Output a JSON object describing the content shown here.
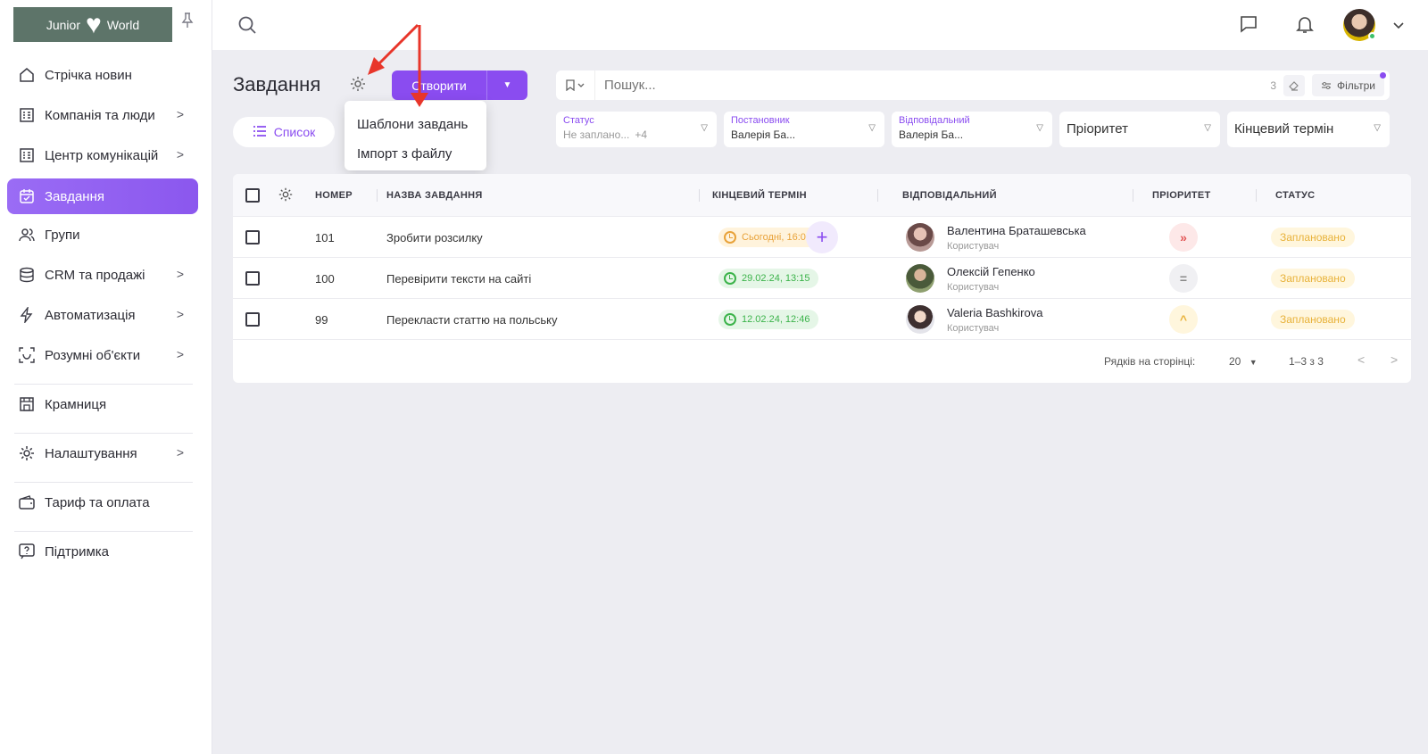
{
  "sidebar": {
    "logo_left": "Junior",
    "logo_right": "World",
    "items": [
      {
        "label": "Стрічка новин",
        "icon": "home-icon",
        "chevron": false
      },
      {
        "label": "Компанія та люди",
        "icon": "building-icon",
        "chevron": true
      },
      {
        "label": "Центр комунікацій",
        "icon": "building-icon",
        "chevron": true
      },
      {
        "label": "Завдання",
        "icon": "calendar-check-icon",
        "chevron": false,
        "active": true
      },
      {
        "label": "Групи",
        "icon": "users-icon",
        "chevron": false
      },
      {
        "label": "CRM та продажі",
        "icon": "database-icon",
        "chevron": true
      },
      {
        "label": "Автоматизація",
        "icon": "bolt-icon",
        "chevron": true
      },
      {
        "label": "Розумні об'єкти",
        "icon": "scan-icon",
        "chevron": true
      },
      {
        "label": "Крамниця",
        "icon": "store-icon",
        "chevron": false
      },
      {
        "label": "Налаштування",
        "icon": "gear-icon",
        "chevron": true
      },
      {
        "label": "Тариф та оплата",
        "icon": "wallet-icon",
        "chevron": false
      },
      {
        "label": "Підтримка",
        "icon": "help-icon",
        "chevron": false
      }
    ]
  },
  "header": {
    "title": "Завдання",
    "create_label": "Створити",
    "view_label": "Список",
    "dropdown": [
      "Шаблони завдань",
      "Імпорт з файлу"
    ]
  },
  "search": {
    "placeholder": "Пошук...",
    "count": "3",
    "filters_label": "Фільтри"
  },
  "filters": [
    {
      "label": "Статус",
      "value": "Не заплано...",
      "more": "+4"
    },
    {
      "label": "Постановник",
      "value": "Валерія Ба..."
    },
    {
      "label": "Відповідальний",
      "value": "Валерія Ба..."
    },
    {
      "label": "",
      "value": "Пріоритет"
    },
    {
      "label": "",
      "value": "Кінцевий термін"
    }
  ],
  "table": {
    "columns": [
      "НОМЕР",
      "НАЗВА ЗАВДАННЯ",
      "КІНЦЕВИЙ ТЕРМІН",
      "ВІДПОВІДАЛЬНИЙ",
      "ПРІОРИТЕТ",
      "СТАТУС"
    ],
    "rows": [
      {
        "number": "101",
        "name": "Зробити розсилку",
        "deadline": "Сьогодні, 16:00",
        "deadline_color": "orange",
        "assignee": "Валентина Браташевська",
        "role": "Користувач",
        "priority": "high",
        "status": "Заплановано"
      },
      {
        "number": "100",
        "name": "Перевірити тексти на сайті",
        "deadline": "29.02.24, 13:15",
        "deadline_color": "green",
        "assignee": "Олексій Гепенко",
        "role": "Користувач",
        "priority": "normal",
        "status": "Заплановано"
      },
      {
        "number": "99",
        "name": "Перекласти статтю на польську",
        "deadline": "12.02.24, 12:46",
        "deadline_color": "green",
        "assignee": "Valeria Bashkirova",
        "role": "Користувач",
        "priority": "low",
        "status": "Заплановано"
      }
    ],
    "footer": {
      "rows_per_page_label": "Рядків на сторінці:",
      "rows_per_page": "20",
      "range": "1–3 з 3"
    }
  },
  "colors": {
    "accent": "#8a4cf0",
    "annotation_arrow": "#e8352a"
  }
}
